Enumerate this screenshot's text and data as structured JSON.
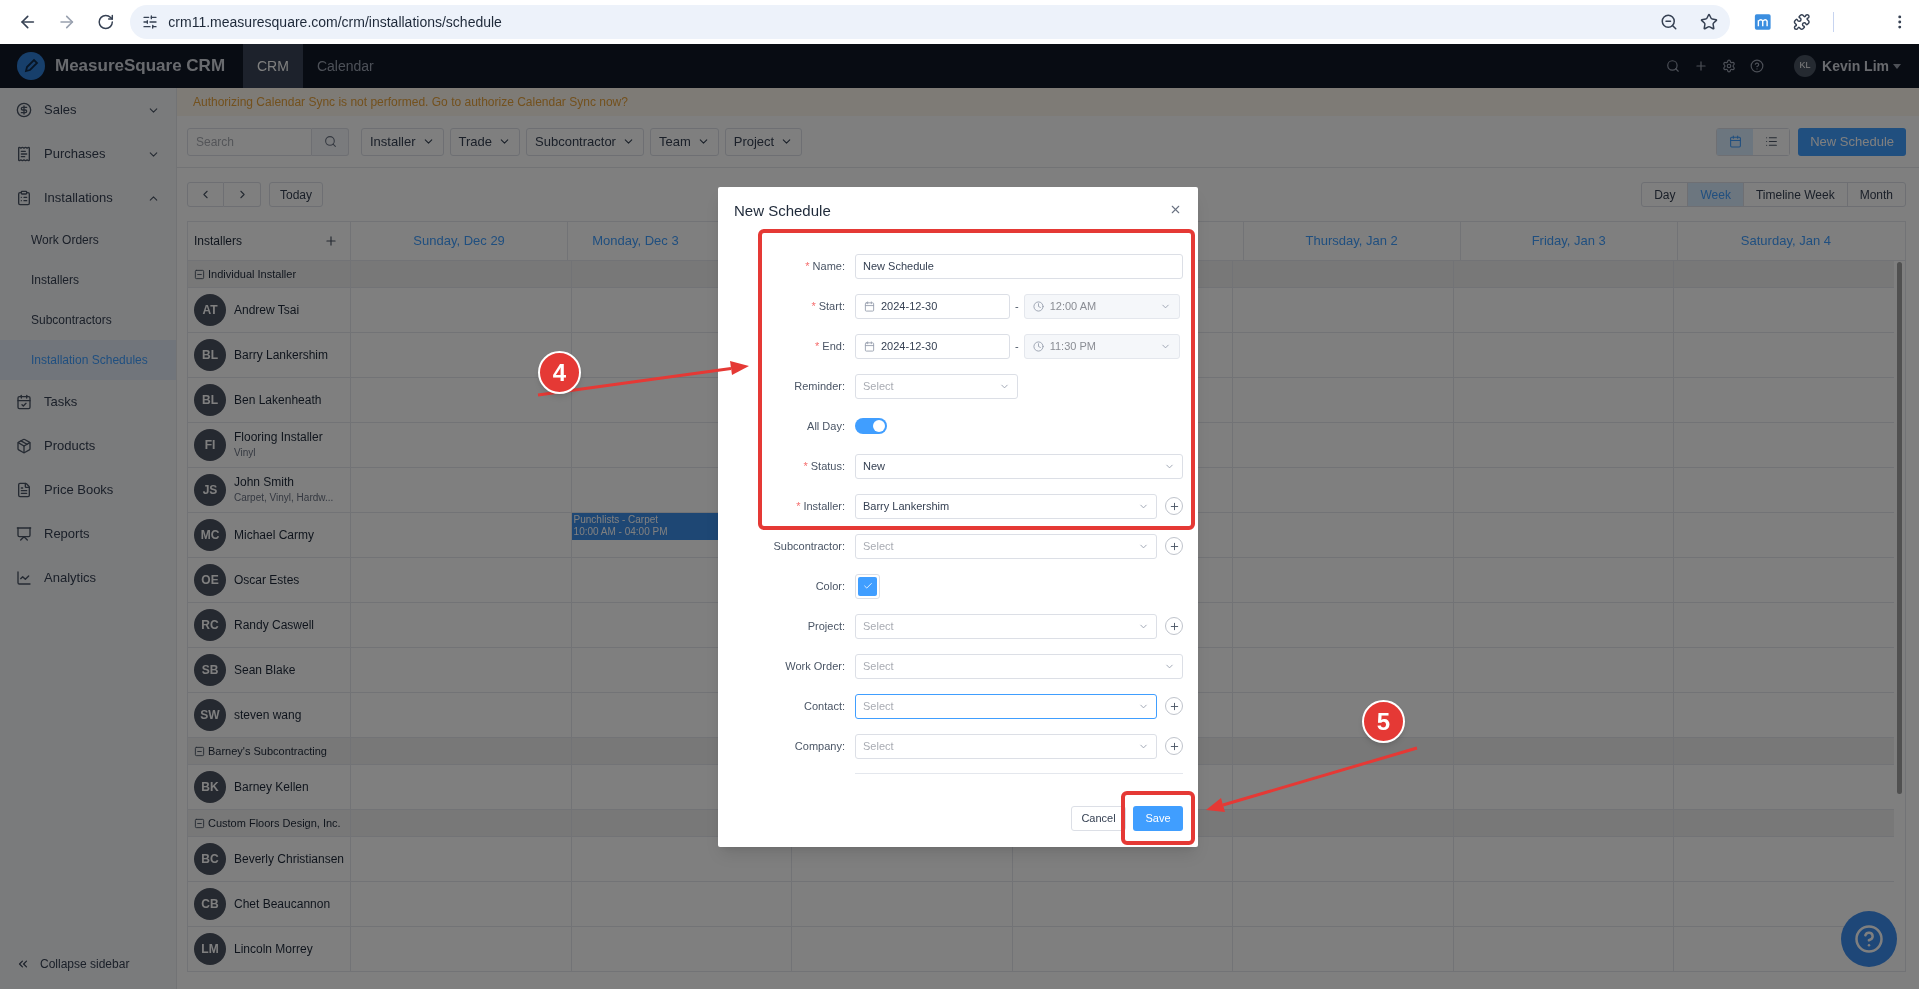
{
  "browser": {
    "url": "crm11.measuresquare.com/crm/installations/schedule"
  },
  "header": {
    "brand": "MeasureSquare CRM",
    "tabs": [
      {
        "label": "CRM",
        "selected": true
      },
      {
        "label": "Calendar",
        "selected": false
      }
    ],
    "user": {
      "initials": "KL",
      "name": "Kevin Lim"
    }
  },
  "sidebar": {
    "items": [
      {
        "label": "Sales",
        "selected": false,
        "expanded": false
      },
      {
        "label": "Purchases",
        "selected": false,
        "expanded": false
      },
      {
        "label": "Installations",
        "selected": false,
        "expanded": true,
        "children": [
          {
            "label": "Work Orders",
            "selected": false
          },
          {
            "label": "Installers",
            "selected": false
          },
          {
            "label": "Subcontractors",
            "selected": false
          },
          {
            "label": "Installation Schedules",
            "selected": true
          }
        ]
      },
      {
        "label": "Tasks",
        "selected": false
      },
      {
        "label": "Products",
        "selected": false
      },
      {
        "label": "Price Books",
        "selected": false
      },
      {
        "label": "Reports",
        "selected": false
      },
      {
        "label": "Analytics",
        "selected": false
      }
    ],
    "collapse_label": "Collapse sidebar"
  },
  "banner": "Authorizing Calendar Sync is not performed. Go to authorize Calendar Sync now?",
  "toolbar": {
    "search_placeholder": "Search",
    "filters": [
      "Installer",
      "Trade",
      "Subcontractor",
      "Team",
      "Project"
    ],
    "views": [
      {
        "kind": "calendar",
        "selected": true
      },
      {
        "kind": "list",
        "selected": false
      }
    ],
    "new_button": "New Schedule"
  },
  "navigation": {
    "today": "Today",
    "ranges": [
      {
        "label": "Day",
        "selected": false
      },
      {
        "label": "Week",
        "selected": true
      },
      {
        "label": "Timeline Week",
        "selected": false
      },
      {
        "label": "Month",
        "selected": false
      }
    ]
  },
  "calendar": {
    "installers_heading": "Installers",
    "days": [
      "Sunday, Dec 29",
      "Monday, Dec 3",
      "Thursday, Jan 2",
      "Friday, Jan 3",
      "Saturday, Jan 4"
    ],
    "groups": [
      {
        "name": "Individual Installer",
        "expanded": true,
        "installers": [
          {
            "initials": "AT",
            "name": "Andrew Tsai"
          },
          {
            "initials": "BL",
            "name": "Barry Lankershim"
          },
          {
            "initials": "BL",
            "name": "Ben Lakenheath"
          },
          {
            "initials": "FI",
            "name": "Flooring Installer",
            "trades": "Vinyl"
          },
          {
            "initials": "JS",
            "name": "John Smith",
            "trades": "Carpet, Vinyl, Hardw..."
          },
          {
            "initials": "MC",
            "name": "Michael Carmy",
            "cells": [
              {},
              {
                "events": [
                  {
                    "title": "Punchlists - Carpet",
                    "time": "10:00 AM - 04:00 PM"
                  }
                ]
              },
              {},
              {},
              {},
              {},
              {}
            ]
          },
          {
            "initials": "OE",
            "name": "Oscar Estes"
          },
          {
            "initials": "RC",
            "name": "Randy Caswell"
          },
          {
            "initials": "SB",
            "name": "Sean Blake"
          },
          {
            "initials": "SW",
            "name": "steven wang"
          }
        ]
      },
      {
        "name": "Barney's Subcontracting",
        "expanded": true,
        "installers": [
          {
            "initials": "BK",
            "name": "Barney Kellen"
          }
        ]
      },
      {
        "name": "Custom Floors Design, Inc.",
        "expanded": true,
        "installers": [
          {
            "initials": "BC",
            "name": "Beverly Christiansen"
          },
          {
            "initials": "CB",
            "name": "Chet Beaucannon"
          },
          {
            "initials": "LM",
            "name": "Lincoln Morrey"
          }
        ]
      }
    ]
  },
  "dialog": {
    "title": "New Schedule",
    "required_mark": "*",
    "fields": [
      {
        "kind": "text",
        "label": "Name:",
        "required": true,
        "value": "New Schedule"
      },
      {
        "kind": "datetime",
        "label": "Start:",
        "required": true,
        "date": "2024-12-30",
        "separator": "-",
        "time": "12:00 AM",
        "time_disabled": true
      },
      {
        "kind": "datetime",
        "label": "End:",
        "required": true,
        "date": "2024-12-30",
        "separator": "-",
        "time": "11:30 PM",
        "time_disabled": true
      },
      {
        "kind": "compact_select",
        "label": "Reminder:",
        "required": false,
        "placeholder": "Select"
      },
      {
        "kind": "switch",
        "label": "All Day:",
        "required": false,
        "on": true
      },
      {
        "kind": "select",
        "label": "Status:",
        "required": true,
        "value": "New",
        "addable": false,
        "focused": false
      },
      {
        "kind": "select",
        "label": "Installer:",
        "required": true,
        "value": "Barry Lankershim",
        "addable": true,
        "focused": false
      },
      {
        "kind": "select",
        "label": "Subcontractor:",
        "required": false,
        "placeholder": "Select",
        "addable": true,
        "focused": false
      },
      {
        "kind": "color",
        "label": "Color:",
        "required": false,
        "color": "#409eff"
      },
      {
        "kind": "select",
        "label": "Project:",
        "required": false,
        "placeholder": "Select",
        "addable": true,
        "focused": false
      },
      {
        "kind": "select",
        "label": "Work Order:",
        "required": false,
        "placeholder": "Select",
        "addable": false,
        "focused": false
      },
      {
        "kind": "select",
        "label": "Contact:",
        "required": false,
        "placeholder": "Select",
        "addable": true,
        "focused": true
      },
      {
        "kind": "select",
        "label": "Company:",
        "required": false,
        "placeholder": "Select",
        "addable": true,
        "focused": false
      }
    ],
    "cancel": "Cancel",
    "save": "Save"
  },
  "annotations": [
    {
      "label": "4"
    },
    {
      "label": "5"
    }
  ]
}
